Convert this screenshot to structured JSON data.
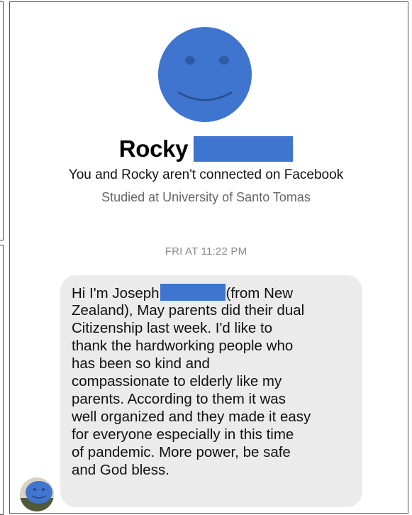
{
  "profile": {
    "name": "Rocky",
    "connection_note": "You and Rocky aren't connected on Facebook",
    "education": "Studied at University of Santo Tomas"
  },
  "conversation": {
    "timestamp": "FRI AT 11:22 PM",
    "message_lines": [
      "Zealand), May parents did their dual",
      "Citizenship last week. I'd like to",
      "thank the hardworking people who",
      "has been so kind and",
      "compassionate to elderly like my",
      "parents. According to them it was",
      "well organized and they made it easy",
      "for everyone especially in this time",
      "of pandemic. More power, be safe",
      "and God bless."
    ],
    "message_first_line_before": "Hi I'm Joseph",
    "message_first_line_after": "(from New"
  },
  "colors": {
    "avatar": "#3f74cf",
    "redaction": "#3f74cf",
    "bubble": "#ebebeb",
    "secondary_text": "#666666",
    "timestamp_text": "#8a8a8a"
  },
  "icons": {
    "profile_avatar": "smiley-face-icon",
    "sender_avatar": "sender-avatar-icon"
  }
}
